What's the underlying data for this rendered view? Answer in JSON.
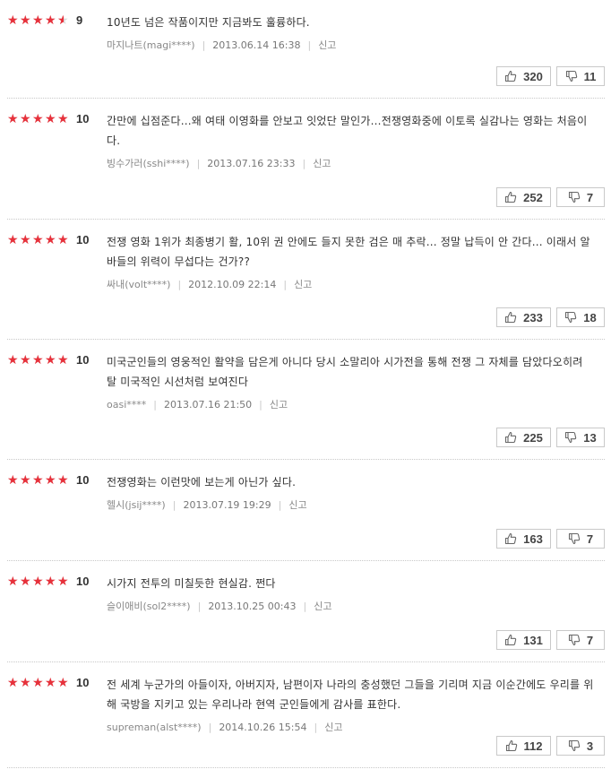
{
  "reviews": [
    {
      "rating": 9,
      "score": "9",
      "text": "10년도 넘은 작품이지만 지금봐도 훌륭하다.",
      "author": "마지나트(magi****)",
      "date": "2013.06.14 16:38",
      "report": "신고",
      "likes": "320",
      "dislikes": "11"
    },
    {
      "rating": 10,
      "score": "10",
      "text": "간만에 십점준다...왜 여태 이영화를 안보고 잇었단 말인가...전쟁영화중에 이토록 실감나는 영화는 처음이다.",
      "author": "빙수가러(sshi****)",
      "date": "2013.07.16 23:33",
      "report": "신고",
      "likes": "252",
      "dislikes": "7"
    },
    {
      "rating": 10,
      "score": "10",
      "text": "전쟁 영화 1위가 최종병기 활, 10위 권 안에도 들지 못한 검은 매 추락... 정말 납득이 안 간다... 이래서 알바들의 위력이 무섭다는 건가??",
      "author": "싸내(volt****)",
      "date": "2012.10.09 22:14",
      "report": "신고",
      "likes": "233",
      "dislikes": "18"
    },
    {
      "rating": 10,
      "score": "10",
      "text": "미국군인들의 영웅적인 활약을 담은게 아니다 당시 소말리아 시가전을 통해 전쟁 그 자체를 담았다오히려 탈 미국적인 시선처럼 보여진다",
      "author": "oasi****",
      "date": "2013.07.16 21:50",
      "report": "신고",
      "likes": "225",
      "dislikes": "13"
    },
    {
      "rating": 10,
      "score": "10",
      "text": "전쟁영화는 이런맛에 보는게 아닌가 싶다.",
      "author": "헬시(jsij****)",
      "date": "2013.07.19 19:29",
      "report": "신고",
      "likes": "163",
      "dislikes": "7"
    },
    {
      "rating": 10,
      "score": "10",
      "text": "시가지 전투의 미칠듯한 현실감. 쩐다",
      "author": "슬이애비(sol2****)",
      "date": "2013.10.25 00:43",
      "report": "신고",
      "likes": "131",
      "dislikes": "7"
    },
    {
      "rating": 10,
      "score": "10",
      "text": "전 세계 누군가의 아들이자, 아버지자, 남편이자 나라의 충성했던 그들을 기리며 지금 이순간에도 우리를 위해 국방을 지키고 있는 우리나라 현역 군인들에게 감사를 표한다.",
      "author": "supreman(alst****)",
      "date": "2014.10.26 15:54",
      "report": "신고",
      "likes": "112",
      "dislikes": "3"
    }
  ],
  "colors": {
    "star": "#e7313b",
    "star_empty": "#d9d9d9"
  },
  "icons": {
    "like": "thumbs-up-icon",
    "dislike": "thumbs-down-icon",
    "star": "star-icon"
  }
}
